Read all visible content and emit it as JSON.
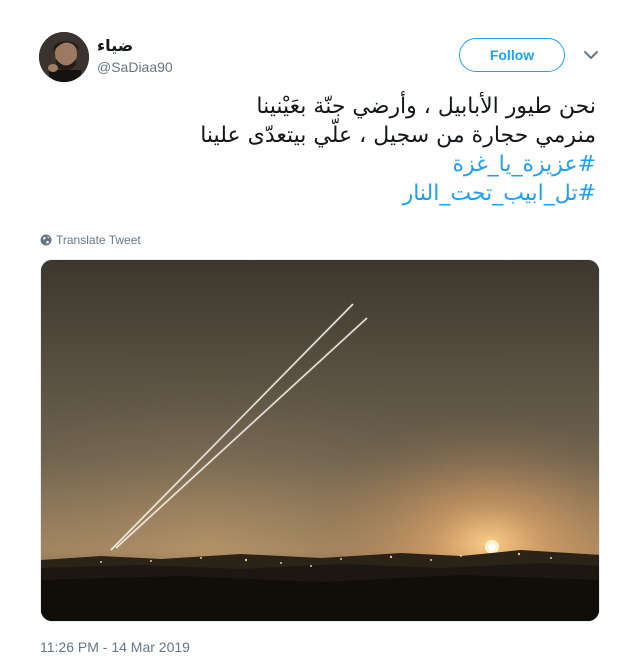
{
  "author": {
    "display_name": "ضياء",
    "handle": "@SaDiaa90"
  },
  "actions": {
    "follow_label": "Follow"
  },
  "tweet": {
    "lines": [
      "نحن طيور الأبابيل ، وأرضي جنّة بعَيْنينا",
      "منرمي حجارة من سجيل ، علّي بيتعدّى علينا"
    ],
    "hashtags": [
      "#عزيزة_يا_غزة",
      "#تل_ابيب_تحت_النار"
    ],
    "translate_label": "Translate Tweet",
    "timestamp": "11:26 PM - 14 Mar 2019"
  },
  "colors": {
    "accent": "#1da1f2",
    "secondary_text": "#657786",
    "primary_text": "#14171a"
  }
}
